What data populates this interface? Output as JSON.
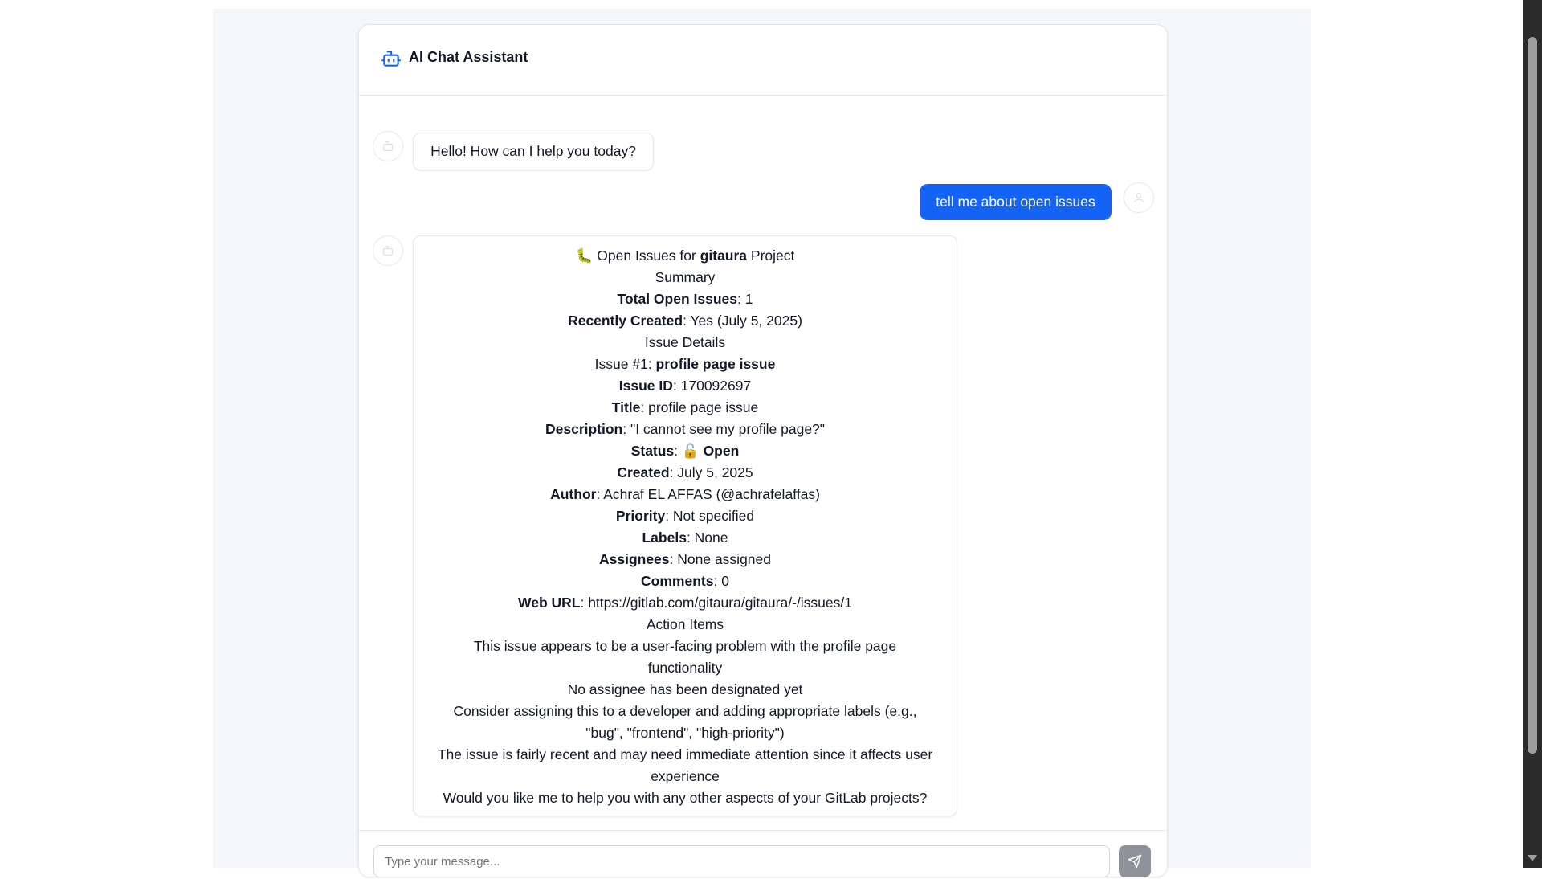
{
  "app": {
    "title": "AI Chat Assistant"
  },
  "messages": [
    {
      "role": "assistant",
      "text": "Hello! How can I help you today?"
    },
    {
      "role": "user",
      "text": "tell me about open issues"
    }
  ],
  "report": {
    "heading_icon": "🐛",
    "heading_prefix": "Open Issues for ",
    "heading_project": "gitaura",
    "heading_suffix": " Project",
    "summary_title": "Summary",
    "total_label": "Total Open Issues",
    "total_value": ": 1",
    "recent_label": "Recently Created",
    "recent_value": ": Yes (July 5, 2025)",
    "details_title": "Issue Details",
    "issue_prefix": "Issue #1: ",
    "issue_name": "profile page issue",
    "id_label": "Issue ID",
    "id_value": ": 170092697",
    "title_label": "Title",
    "title_value": ": profile page issue",
    "desc_label": "Description",
    "desc_value": ": \"I cannot see my profile page?\"",
    "status_label": "Status",
    "status_sep": ": ",
    "status_icon": "🔓",
    "status_value": " Open",
    "created_label": "Created",
    "created_value": ": July 5, 2025",
    "author_label": "Author",
    "author_value": ": Achraf EL AFFAS (@achrafelaffas)",
    "priority_label": "Priority",
    "priority_value": ": Not specified",
    "labels_label": "Labels",
    "labels_value": ": None",
    "assignees_label": "Assignees",
    "assignees_value": ": None assigned",
    "comments_label": "Comments",
    "comments_value": ": 0",
    "url_label": "Web URL",
    "url_value": ": https://gitlab.com/gitaura/gitaura/-/issues/1",
    "actions_title": "Action Items",
    "action_1a": "This issue appears to be a user-facing problem with the profile page",
    "action_1b": "functionality",
    "action_2": "No assignee has been designated yet",
    "action_3a": "Consider assigning this to a developer and adding appropriate labels (e.g.,",
    "action_3b": "\"bug\", \"frontend\", \"high-priority\")",
    "action_4a": "The issue is fairly recent and may need immediate attention since it affects user",
    "action_4b": "experience",
    "closing": "Would you like me to help you with any other aspects of your GitLab projects?"
  },
  "composer": {
    "placeholder": "Type your message..."
  },
  "colors": {
    "accent": "#1463f5",
    "send_button": "#8e939b"
  }
}
